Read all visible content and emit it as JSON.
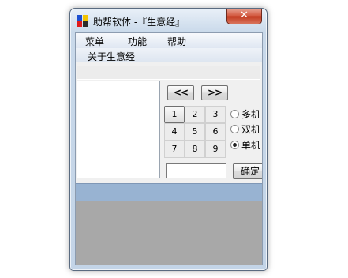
{
  "window": {
    "title": "助帮软体 -『生意经』",
    "close_label": "✕"
  },
  "menu": {
    "items": [
      "菜单",
      "功能",
      "帮助"
    ],
    "submenu_item": "关于生意经"
  },
  "nav": {
    "prev_label": "<<",
    "next_label": ">>"
  },
  "keypad": [
    "1",
    "2",
    "3",
    "4",
    "5",
    "6",
    "7",
    "8",
    "9"
  ],
  "radios": [
    {
      "label": "多机",
      "checked": false
    },
    {
      "label": "双机",
      "checked": false
    },
    {
      "label": "单机",
      "checked": true
    }
  ],
  "input": {
    "value": ""
  },
  "confirm_label": "确定",
  "colors": {
    "panel_header": "#98b3d2",
    "panel_body": "#a8a8a8",
    "close_button": "#c9462b"
  }
}
